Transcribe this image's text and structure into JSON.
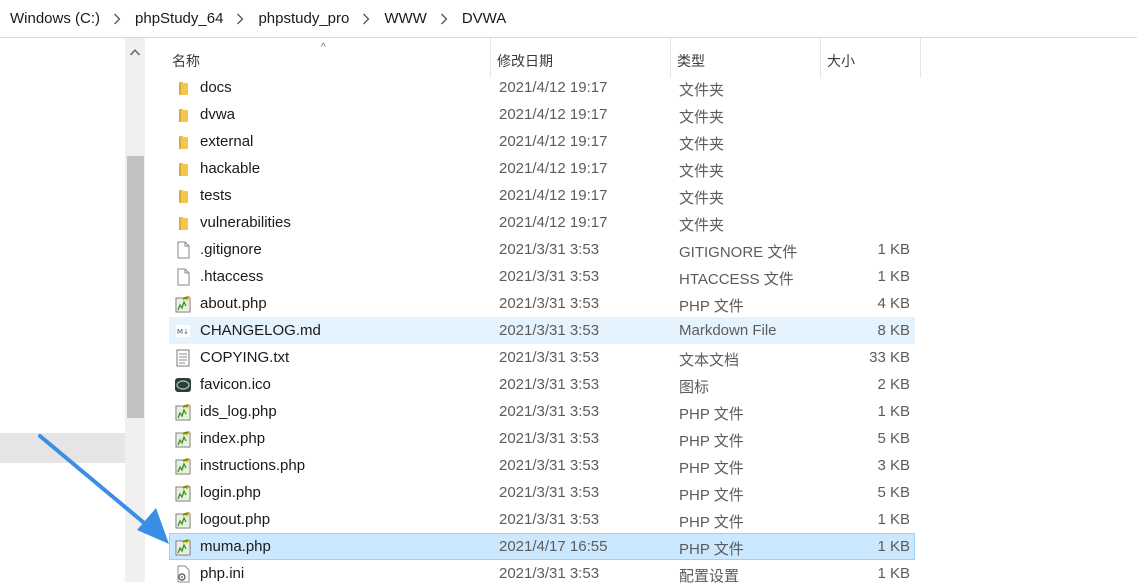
{
  "breadcrumb": [
    "Windows (C:)",
    "phpStudy_64",
    "phpstudy_pro",
    "WWW",
    "DVWA"
  ],
  "columns": {
    "name": "名称",
    "date": "修改日期",
    "type": "类型",
    "size": "大小"
  },
  "files": [
    {
      "name": "docs",
      "date": "2021/4/12 19:17",
      "type": "文件夹",
      "size": "",
      "icon": "folder-icon"
    },
    {
      "name": "dvwa",
      "date": "2021/4/12 19:17",
      "type": "文件夹",
      "size": "",
      "icon": "folder-icon"
    },
    {
      "name": "external",
      "date": "2021/4/12 19:17",
      "type": "文件夹",
      "size": "",
      "icon": "folder-icon"
    },
    {
      "name": "hackable",
      "date": "2021/4/12 19:17",
      "type": "文件夹",
      "size": "",
      "icon": "folder-icon"
    },
    {
      "name": "tests",
      "date": "2021/4/12 19:17",
      "type": "文件夹",
      "size": "",
      "icon": "folder-icon"
    },
    {
      "name": "vulnerabilities",
      "date": "2021/4/12 19:17",
      "type": "文件夹",
      "size": "",
      "icon": "folder-icon"
    },
    {
      "name": ".gitignore",
      "date": "2021/3/31 3:53",
      "type": "GITIGNORE 文件",
      "size": "1 KB",
      "icon": "blank-file-icon"
    },
    {
      "name": ".htaccess",
      "date": "2021/3/31 3:53",
      "type": "HTACCESS 文件",
      "size": "1 KB",
      "icon": "blank-file-icon"
    },
    {
      "name": "about.php",
      "date": "2021/3/31 3:53",
      "type": "PHP 文件",
      "size": "4 KB",
      "icon": "php-file-icon"
    },
    {
      "name": "CHANGELOG.md",
      "date": "2021/3/31 3:53",
      "type": "Markdown File",
      "size": "8 KB",
      "icon": "markdown-file-icon",
      "state": "hover"
    },
    {
      "name": "COPYING.txt",
      "date": "2021/3/31 3:53",
      "type": "文本文档",
      "size": "33 KB",
      "icon": "text-file-icon"
    },
    {
      "name": "favicon.ico",
      "date": "2021/3/31 3:53",
      "type": "图标",
      "size": "2 KB",
      "icon": "ico-file-icon"
    },
    {
      "name": "ids_log.php",
      "date": "2021/3/31 3:53",
      "type": "PHP 文件",
      "size": "1 KB",
      "icon": "php-file-icon"
    },
    {
      "name": "index.php",
      "date": "2021/3/31 3:53",
      "type": "PHP 文件",
      "size": "5 KB",
      "icon": "php-file-icon"
    },
    {
      "name": "instructions.php",
      "date": "2021/3/31 3:53",
      "type": "PHP 文件",
      "size": "3 KB",
      "icon": "php-file-icon"
    },
    {
      "name": "login.php",
      "date": "2021/3/31 3:53",
      "type": "PHP 文件",
      "size": "5 KB",
      "icon": "php-file-icon"
    },
    {
      "name": "logout.php",
      "date": "2021/3/31 3:53",
      "type": "PHP 文件",
      "size": "1 KB",
      "icon": "php-file-icon"
    },
    {
      "name": "muma.php",
      "date": "2021/4/17 16:55",
      "type": "PHP 文件",
      "size": "1 KB",
      "icon": "php-file-icon",
      "state": "selected"
    },
    {
      "name": "php.ini",
      "date": "2021/3/31 3:53",
      "type": "配置设置",
      "size": "1 KB",
      "icon": "settings-file-icon"
    }
  ],
  "colors": {
    "hover": "#e5f3ff",
    "selected": "#cce8ff",
    "selected_border": "#99d1ff",
    "annotation_arrow": "#3a8ee6"
  }
}
